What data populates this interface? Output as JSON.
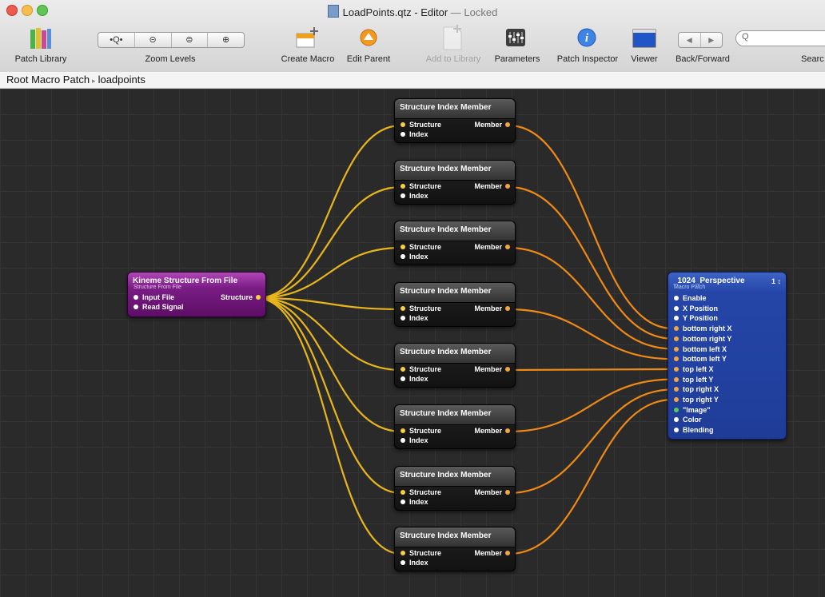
{
  "window": {
    "title": "LoadPoints.qtz - Editor",
    "state": "Locked",
    "title_separator": "—"
  },
  "toolbar": {
    "patch_library": "Patch Library",
    "zoom_levels": "Zoom Levels",
    "zoom_buttons": [
      "•Q•",
      "⊝",
      "⊜",
      "⊕"
    ],
    "create_macro": "Create Macro",
    "edit_parent": "Edit Parent",
    "add_to_library": "Add to Library",
    "parameters": "Parameters",
    "patch_inspector": "Patch Inspector",
    "viewer": "Viewer",
    "back_forward": "Back/Forward",
    "back_arrow": "◀",
    "forward_arrow": "▶",
    "search": "Searc",
    "search_glyph": "Q"
  },
  "breadcrumb": {
    "root": "Root Macro Patch",
    "separator": "▸",
    "current": "loadpoints"
  },
  "source_patch": {
    "title": "Kineme Structure From File",
    "subtitle": "Structure From File",
    "inputs": [
      "Input File",
      "Read Signal"
    ],
    "output": "Structure"
  },
  "index_patch": {
    "title": "Structure Index Member",
    "inputs": [
      "Structure",
      "Index"
    ],
    "output": "Member"
  },
  "macro_patch": {
    "title": "_1024_Perspective",
    "subtitle": "Macro Patch",
    "count": "1 ↕",
    "inputs": [
      "Enable",
      "X Position",
      "Y Position",
      "bottom right X",
      "bottom right Y",
      "bottom left X",
      "bottom left Y",
      "top left X",
      "top left Y",
      "top right X",
      "top right Y",
      "\"Image\"",
      "Color",
      "Blending"
    ]
  },
  "colors": {
    "wire_yellow": "#e8b61a",
    "wire_orange": "#f08a14",
    "port_white": "#ffffff",
    "port_yellow": "#f5d142",
    "port_orange": "#f5a442",
    "port_green": "#58c75a",
    "source_patch": "#7a1d85",
    "macro_patch": "#2546a8"
  },
  "icons": {
    "patch_library": "books-icon",
    "create_macro": "new-macro-icon",
    "edit_parent": "up-arrow-icon",
    "add_to_library": "add-doc-icon",
    "parameters": "sliders-icon",
    "patch_inspector": "info-icon",
    "viewer": "viewer-window-icon",
    "search": "magnifier-icon"
  }
}
